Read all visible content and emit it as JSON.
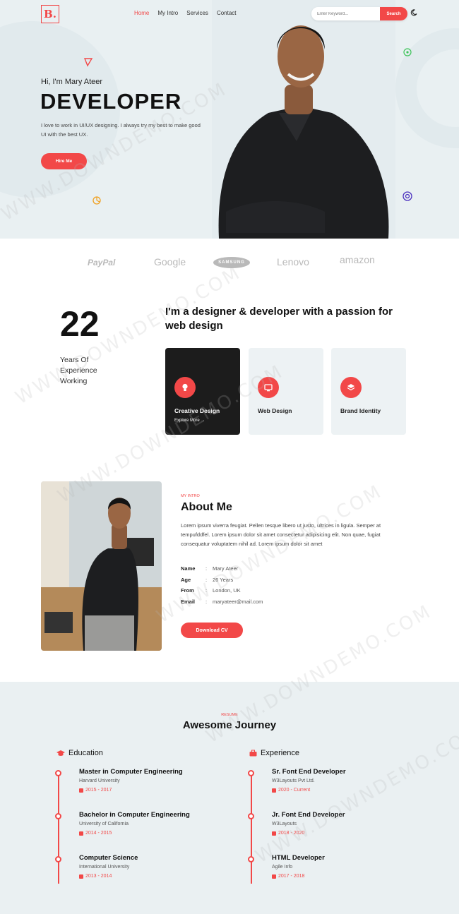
{
  "header": {
    "logo": "B.",
    "nav": [
      "Home",
      "My Intro",
      "Services",
      "Contact"
    ],
    "search_placeholder": "Enter Keyword...",
    "search_button": "Search"
  },
  "hero": {
    "greeting": "Hi, I'm Mary Ateer",
    "title": "DEVELOPER",
    "description": "I love to work in UI/UX designing. I always try my best to make good UI with the best UX.",
    "cta": "Hire Me"
  },
  "brands": [
    "PayPal",
    "Google",
    "SAMSUNG",
    "Lenovo",
    "amazon"
  ],
  "experience": {
    "years": "22",
    "label": "Years Of Experience Working",
    "headline": "I'm a designer & developer with a passion for web design",
    "cards": [
      {
        "title": "Creative Design",
        "link": "Explore More →"
      },
      {
        "title": "Web Design"
      },
      {
        "title": "Brand Identity"
      }
    ]
  },
  "about": {
    "eyebrow": "MY INTRO",
    "title": "About Me",
    "text": "Lorem ipsum viverra feugiat. Pellen tesque libero ut justo, ultrices in ligula. Semper at tempufddfel. Lorem ipsum dolor sit amet consectetur adipisicing elit. Non quae, fugiat consequatur voluptatem nihil ad. Lorem ipsum dolor sit amet",
    "info": [
      {
        "key": "Name",
        "value": "Mary Ateer"
      },
      {
        "key": "Age",
        "value": "26 Years"
      },
      {
        "key": "From",
        "value": "London, UK"
      },
      {
        "key": "Email",
        "value": "maryateer@mail.com"
      }
    ],
    "cta": "Download CV"
  },
  "resume": {
    "eyebrow": "RESUME",
    "title": "Awesome Journey",
    "education_heading": "Education",
    "experience_heading": "Experience",
    "education": [
      {
        "title": "Master in Computer Engineering",
        "sub": "Harvard University",
        "date": "2015 - 2017"
      },
      {
        "title": "Bachelor in Computer Engineering",
        "sub": "University of California",
        "date": "2014 - 2015"
      },
      {
        "title": "Computer Science",
        "sub": "International University",
        "date": "2013 - 2014"
      }
    ],
    "experience": [
      {
        "title": "Sr. Font End Developer",
        "sub": "W3Layouts Pvt Ltd.",
        "date": "2020 - Current"
      },
      {
        "title": "Jr. Font End Developer",
        "sub": "W3Layouts",
        "date": "2018 - 2020"
      },
      {
        "title": "HTML Developer",
        "sub": "Agile Info",
        "date": "2017 - 2018"
      }
    ]
  },
  "watermark": "WWW.DOWNDEMO.COM",
  "colors": {
    "accent": "#f24848",
    "dark_card": "#1c1c1c",
    "light_bg": "#eaf0f2"
  }
}
